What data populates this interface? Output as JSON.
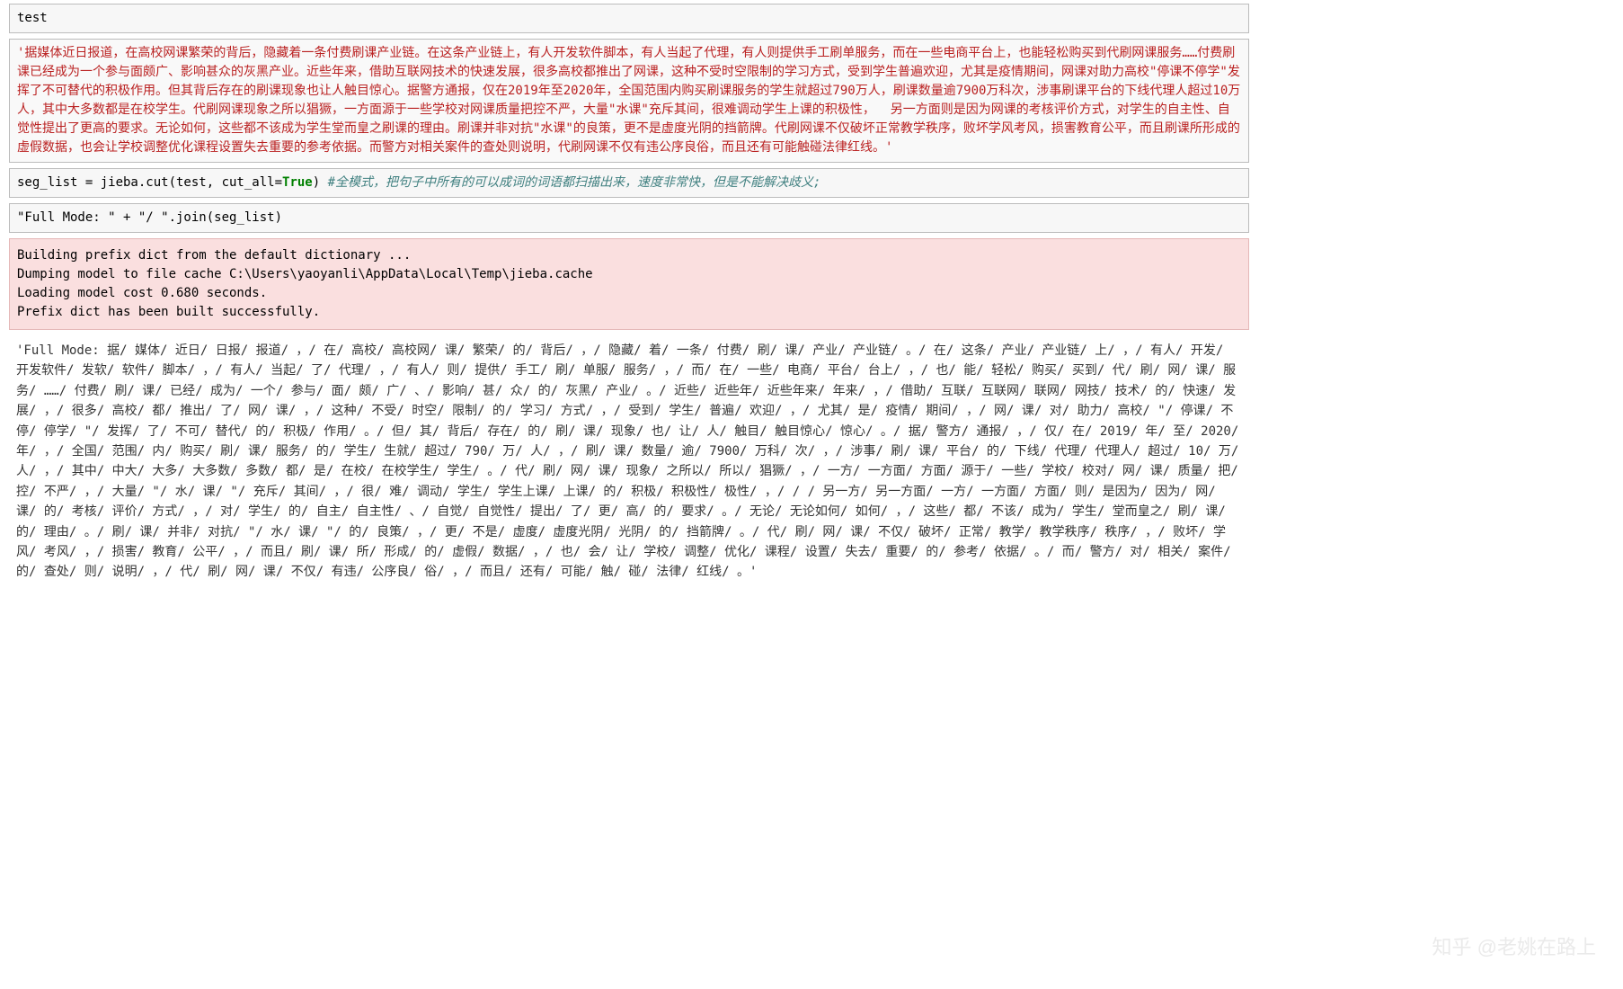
{
  "cell1_text": "test",
  "cell2_str": "'据媒体近日报道，在高校网课繁荣的背后，隐藏着一条付费刷课产业链。在这条产业链上，有人开发软件脚本，有人当起了代理，有人则提供手工刷单服务，而在一些电商平台上，也能轻松购买到代刷网课服务……付费刷课已经成为一个参与面颇广、影响甚众的灰黑产业。近些年来，借助互联网技术的快速发展，很多高校都推出了网课，这种不受时空限制的学习方式，受到学生普遍欢迎，尤其是疫情期间，网课对助力高校\"停课不停学\"发挥了不可替代的积极作用。但其背后存在的刷课现象也让人触目惊心。据警方通报，仅在2019年至2020年，全国范围内购买刷课服务的学生就超过790万人，刷课数量逾7900万科次，涉事刷课平台的下线代理人超过10万人，其中大多数都是在校学生。代刷网课现象之所以猖獗，一方面源于一些学校对网课质量把控不严，大量\"水课\"充斥其间，很难调动学生上课的积极性，  另一方面则是因为网课的考核评价方式，对学生的自主性、自觉性提出了更高的要求。无论如何，这些都不该成为学生堂而皇之刷课的理由。刷课并非对抗\"水课\"的良策，更不是虚度光阴的挡箭牌。代刷网课不仅破坏正常教学秩序，败坏学风考风，损害教育公平，而且刷课所形成的虚假数据，也会让学校调整优化课程设置失去重要的参考依据。而警方对相关案件的查处则说明，代刷网课不仅有违公序良俗，而且还有可能触碰法律红线。'",
  "cell3": {
    "pre": "seg_list = jieba.cut(test, cut_all=",
    "kw": "True",
    "post": ") ",
    "comment": "#全模式，把句子中所有的可以成词的词语都扫描出来，速度非常快，但是不能解决歧义;"
  },
  "cell4_code": "\"Full Mode: \" + \"/ \".join(seg_list)",
  "stderr": "Building prefix dict from the default dictionary ...\nDumping model to file cache C:\\Users\\yaoyanli\\AppData\\Local\\Temp\\jieba.cache\nLoading model cost 0.680 seconds.\nPrefix dict has been built successfully.",
  "stdout": "'Full Mode: 据/ 媒体/ 近日/ 日报/ 报道/ ，/ 在/ 高校/ 高校网/ 课/ 繁荣/ 的/ 背后/ ，/ 隐藏/ 着/ 一条/ 付费/ 刷/ 课/ 产业/ 产业链/ 。/ 在/ 这条/ 产业/ 产业链/ 上/ ，/ 有人/ 开发/ 开发软件/ 发软/ 软件/ 脚本/ ，/ 有人/ 当起/ 了/ 代理/ ，/ 有人/ 则/ 提供/ 手工/ 刷/ 单服/ 服务/ ，/ 而/ 在/ 一些/ 电商/ 平台/ 台上/ ，/ 也/ 能/ 轻松/ 购买/ 买到/ 代/ 刷/ 网/ 课/ 服务/ ……/ 付费/ 刷/ 课/ 已经/ 成为/ 一个/ 参与/ 面/ 颇/ 广/ 、/ 影响/ 甚/ 众/ 的/ 灰黑/ 产业/ 。/ 近些/ 近些年/ 近些年来/ 年来/ ，/ 借助/ 互联/ 互联网/ 联网/ 网技/ 技术/ 的/ 快速/ 发展/ ，/ 很多/ 高校/ 都/ 推出/ 了/ 网/ 课/ ，/ 这种/ 不受/ 时空/ 限制/ 的/ 学习/ 方式/ ，/ 受到/ 学生/ 普遍/ 欢迎/ ，/ 尤其/ 是/ 疫情/ 期间/ ，/ 网/ 课/ 对/ 助力/ 高校/ \"/ 停课/ 不停/ 停学/ \"/ 发挥/ 了/ 不可/ 替代/ 的/ 积极/ 作用/ 。/ 但/ 其/ 背后/ 存在/ 的/ 刷/ 课/ 现象/ 也/ 让/ 人/ 触目/ 触目惊心/ 惊心/ 。/ 据/ 警方/ 通报/ ，/ 仅/ 在/ 2019/ 年/ 至/ 2020/ 年/ ，/ 全国/ 范围/ 内/ 购买/ 刷/ 课/ 服务/ 的/ 学生/ 生就/ 超过/ 790/ 万/ 人/ ，/ 刷/ 课/ 数量/ 逾/ 7900/ 万科/ 次/ ，/ 涉事/ 刷/ 课/ 平台/ 的/ 下线/ 代理/ 代理人/ 超过/ 10/ 万/ 人/ ，/ 其中/ 中大/ 大多/ 大多数/ 多数/ 都/ 是/ 在校/ 在校学生/ 学生/ 。/ 代/ 刷/ 网/ 课/ 现象/ 之所以/ 所以/ 猖獗/ ，/ 一方/ 一方面/ 方面/ 源于/ 一些/ 学校/ 校对/ 网/ 课/ 质量/ 把/ 控/ 不严/ ，/ 大量/ \"/ 水/ 课/ \"/ 充斥/ 其间/ ，/ 很/ 难/ 调动/ 学生/ 学生上课/ 上课/ 的/ 积极/ 积极性/ 极性/ ，/ / / 另一方/ 另一方面/ 一方/ 一方面/ 方面/ 则/ 是因为/ 因为/ 网/ 课/ 的/ 考核/ 评价/ 方式/ ，/ 对/ 学生/ 的/ 自主/ 自主性/ 、/ 自觉/ 自觉性/ 提出/ 了/ 更/ 高/ 的/ 要求/ 。/ 无论/ 无论如何/ 如何/ ，/ 这些/ 都/ 不该/ 成为/ 学生/ 堂而皇之/ 刷/ 课/ 的/ 理由/ 。/ 刷/ 课/ 并非/ 对抗/ \"/ 水/ 课/ \"/ 的/ 良策/ ，/ 更/ 不是/ 虚度/ 虚度光阴/ 光阴/ 的/ 挡箭牌/ 。/ 代/ 刷/ 网/ 课/ 不仅/ 破坏/ 正常/ 教学/ 教学秩序/ 秩序/ ，/ 败坏/ 学风/ 考风/ ，/ 损害/ 教育/ 公平/ ，/ 而且/ 刷/ 课/ 所/ 形成/ 的/ 虚假/ 数据/ ，/ 也/ 会/ 让/ 学校/ 调整/ 优化/ 课程/ 设置/ 失去/ 重要/ 的/ 参考/ 依据/ 。/ 而/ 警方/ 对/ 相关/ 案件/ 的/ 查处/ 则/ 说明/ ，/ 代/ 刷/ 网/ 课/ 不仅/ 有违/ 公序良/ 俗/ ，/ 而且/ 还有/ 可能/ 触/ 碰/ 法律/ 红线/ 。'",
  "watermark": "知乎 @老姚在路上"
}
